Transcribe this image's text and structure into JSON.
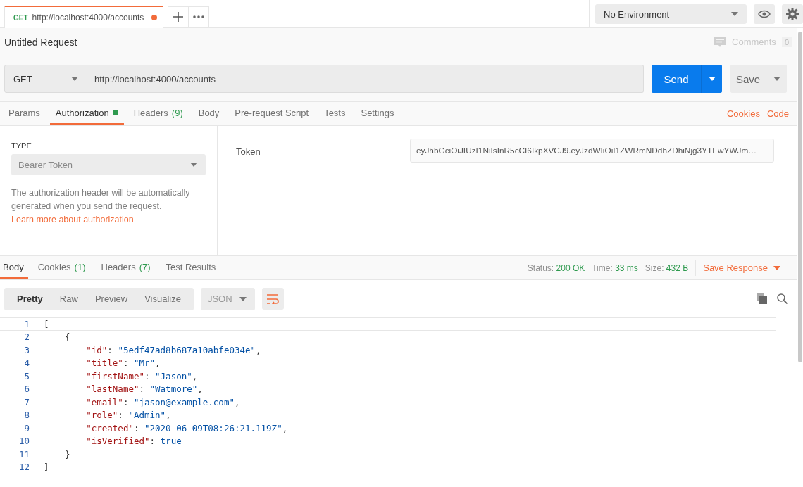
{
  "request_tabs": [
    {
      "method": "GET",
      "label": "http://localhost:4000/accounts",
      "selected": true,
      "unsaved": true
    }
  ],
  "environment": {
    "value": "No Environment"
  },
  "request": {
    "title": "Untitled Request",
    "comments_label": "Comments",
    "comments_count": "0",
    "method": "GET",
    "url": "http://localhost:4000/accounts",
    "send": "Send",
    "save": "Save"
  },
  "request_sections": [
    {
      "label": "Params",
      "selected": false
    },
    {
      "label": "Authorization",
      "selected": true,
      "dot": true
    },
    {
      "label": "Headers",
      "count": "(9)",
      "selected": false
    },
    {
      "label": "Body",
      "selected": false
    },
    {
      "label": "Pre-request Script",
      "selected": false
    },
    {
      "label": "Tests",
      "selected": false
    },
    {
      "label": "Settings",
      "selected": false
    }
  ],
  "request_links": [
    "Cookies",
    "Code"
  ],
  "auth": {
    "type_label": "TYPE",
    "type": "Bearer Token",
    "help": "The authorization header will be automatically generated when you send the request.",
    "help_link": "Learn more about authorization",
    "token_label": "Token",
    "token": "eyJhbGciOiJIUzI1NiIsInR5cCI6IkpXVCJ9.eyJzdWIiOiI1ZWRmNDdhZDhiNjg3YTEwYWJm…"
  },
  "response_sections": [
    {
      "label": "Body",
      "selected": true
    },
    {
      "label": "Cookies",
      "count": "(1)",
      "selected": false
    },
    {
      "label": "Headers",
      "count": "(7)",
      "selected": false
    },
    {
      "label": "Test Results",
      "selected": false
    }
  ],
  "response_meta": [
    {
      "label": "Status:",
      "value": "200 OK"
    },
    {
      "label": "Time:",
      "value": "33 ms"
    },
    {
      "label": "Size:",
      "value": "432 B"
    }
  ],
  "save_response": "Save Response",
  "view_modes": [
    {
      "label": "Pretty",
      "selected": true
    },
    {
      "label": "Raw",
      "selected": false
    },
    {
      "label": "Preview",
      "selected": false
    },
    {
      "label": "Visualize",
      "selected": false
    }
  ],
  "format": "JSON",
  "code_lines": [
    {
      "number": "1",
      "tokens": [
        {
          "kind": "punct",
          "text": "["
        }
      ]
    },
    {
      "number": "2",
      "tokens": [
        {
          "kind": "punct",
          "text": "    {"
        }
      ]
    },
    {
      "number": "3",
      "tokens": [
        {
          "kind": "key",
          "text": "        \"id\""
        },
        {
          "kind": "punct",
          "text": ": "
        },
        {
          "kind": "string",
          "text": "\"5edf47ad8b687a10abfe034e\""
        },
        {
          "kind": "punct",
          "text": ","
        }
      ]
    },
    {
      "number": "4",
      "tokens": [
        {
          "kind": "key",
          "text": "        \"title\""
        },
        {
          "kind": "punct",
          "text": ": "
        },
        {
          "kind": "string",
          "text": "\"Mr\""
        },
        {
          "kind": "punct",
          "text": ","
        }
      ]
    },
    {
      "number": "5",
      "tokens": [
        {
          "kind": "key",
          "text": "        \"firstName\""
        },
        {
          "kind": "punct",
          "text": ": "
        },
        {
          "kind": "string",
          "text": "\"Jason\""
        },
        {
          "kind": "punct",
          "text": ","
        }
      ]
    },
    {
      "number": "6",
      "tokens": [
        {
          "kind": "key",
          "text": "        \"lastName\""
        },
        {
          "kind": "punct",
          "text": ": "
        },
        {
          "kind": "string",
          "text": "\"Watmore\""
        },
        {
          "kind": "punct",
          "text": ","
        }
      ]
    },
    {
      "number": "7",
      "tokens": [
        {
          "kind": "key",
          "text": "        \"email\""
        },
        {
          "kind": "punct",
          "text": ": "
        },
        {
          "kind": "string",
          "text": "\"jason@example.com\""
        },
        {
          "kind": "punct",
          "text": ","
        }
      ]
    },
    {
      "number": "8",
      "tokens": [
        {
          "kind": "key",
          "text": "        \"role\""
        },
        {
          "kind": "punct",
          "text": ": "
        },
        {
          "kind": "string",
          "text": "\"Admin\""
        },
        {
          "kind": "punct",
          "text": ","
        }
      ]
    },
    {
      "number": "9",
      "tokens": [
        {
          "kind": "key",
          "text": "        \"created\""
        },
        {
          "kind": "punct",
          "text": ": "
        },
        {
          "kind": "string",
          "text": "\"2020-06-09T08:26:21.119Z\""
        },
        {
          "kind": "punct",
          "text": ","
        }
      ]
    },
    {
      "number": "10",
      "tokens": [
        {
          "kind": "key",
          "text": "        \"isVerified\""
        },
        {
          "kind": "punct",
          "text": ": "
        },
        {
          "kind": "literal",
          "text": "true"
        }
      ]
    },
    {
      "number": "11",
      "tokens": [
        {
          "kind": "punct",
          "text": "    }"
        }
      ]
    },
    {
      "number": "12",
      "tokens": [
        {
          "kind": "punct",
          "text": "]"
        }
      ]
    }
  ]
}
